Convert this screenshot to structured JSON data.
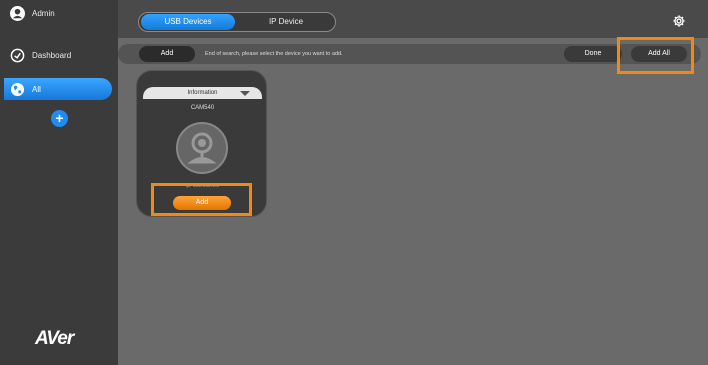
{
  "sidebar": {
    "admin_label": "Admin",
    "dashboard_label": "Dashboard",
    "all_label": "All",
    "add_symbol": "+",
    "logo": "AVer"
  },
  "tabs": {
    "usb": "USB Devices",
    "ip": "IP Device"
  },
  "actionbar": {
    "add_label": "Add",
    "message": "End of search, please select the device you want to add.",
    "done_label": "Done",
    "add_all_label": "Add All"
  },
  "device_card": {
    "info_label": "Information",
    "model": "CAM540",
    "ip": "Ip: 192.168.1.2",
    "add_label": "Add"
  },
  "colors": {
    "accent_blue": "#1e8cf0",
    "highlight_orange": "#f28a12",
    "add_orange": "#f08a1a"
  }
}
